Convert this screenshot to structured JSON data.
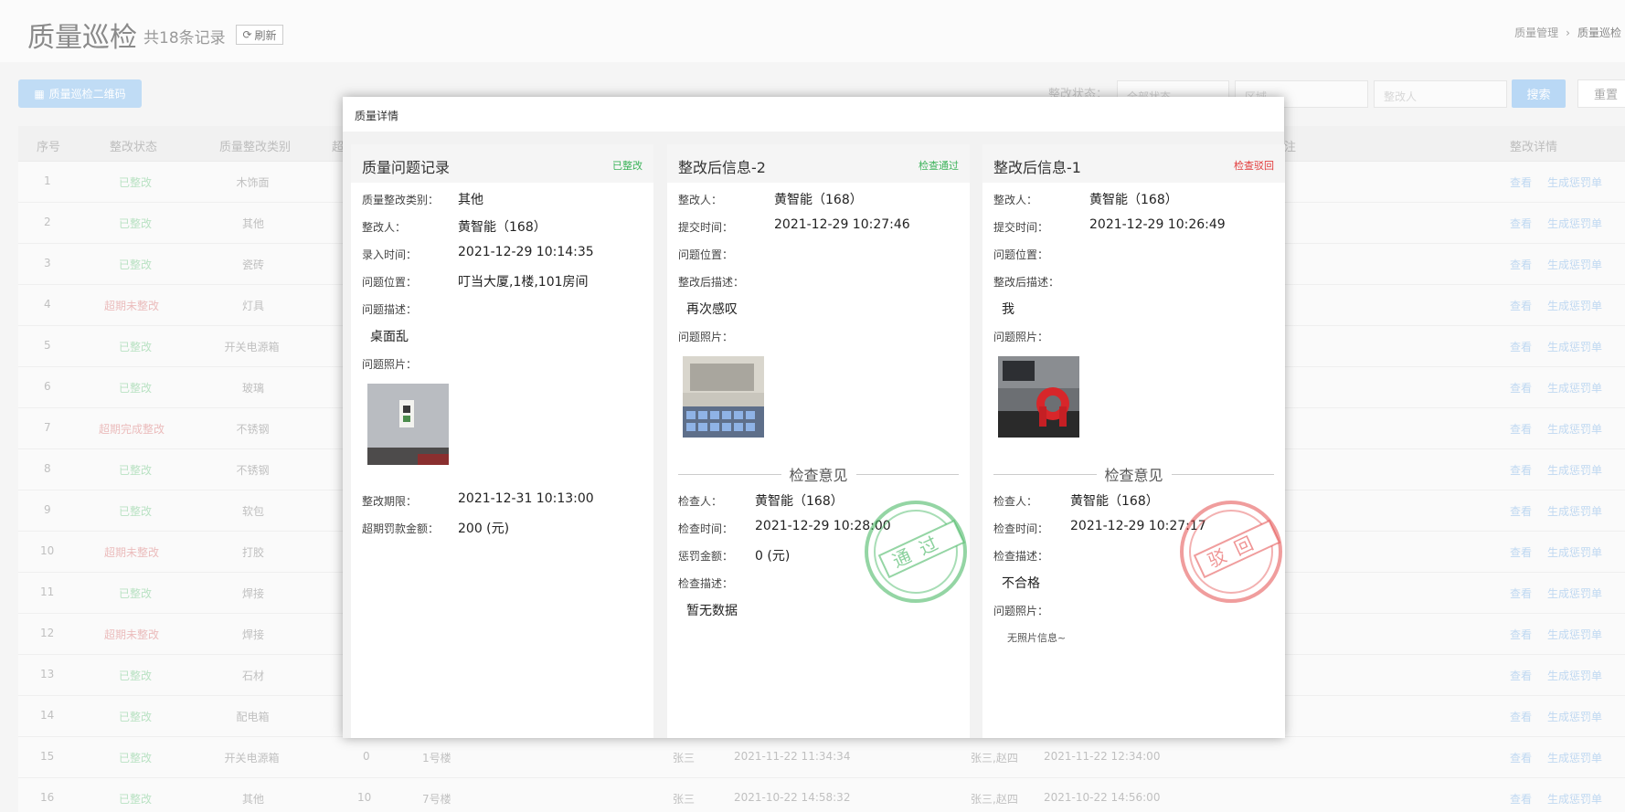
{
  "header": {
    "title": "质量巡检",
    "count": "共18条记录",
    "refresh_label": "刷新",
    "breadcrumb": [
      "质量管理",
      "质量巡检"
    ]
  },
  "toolbar": {
    "qr_button": "质量巡检二维码",
    "filter_label": "整改状态：",
    "status_select": "全部状态",
    "area_placeholder": "区域",
    "person_placeholder": "整改人",
    "search_label": "搜索",
    "reset_label": "重置"
  },
  "table": {
    "headers": {
      "seq": "序号",
      "status": "整改状态",
      "category": "质量整改类别",
      "overdue": "超",
      "remark": "注",
      "details": "整改详情"
    },
    "rows": [
      {
        "seq": "1",
        "status": "已整改",
        "category": "木饰面"
      },
      {
        "seq": "2",
        "status": "已整改",
        "category": "其他"
      },
      {
        "seq": "3",
        "status": "已整改",
        "category": "瓷砖"
      },
      {
        "seq": "4",
        "status": "超期未整改",
        "category": "灯具"
      },
      {
        "seq": "5",
        "status": "已整改",
        "category": "开关电源箱"
      },
      {
        "seq": "6",
        "status": "已整改",
        "category": "玻璃"
      },
      {
        "seq": "7",
        "status": "超期完成整改",
        "category": "不锈钢"
      },
      {
        "seq": "8",
        "status": "已整改",
        "category": "不锈钢"
      },
      {
        "seq": "9",
        "status": "已整改",
        "category": "软包"
      },
      {
        "seq": "10",
        "status": "超期未整改",
        "category": "打胶"
      },
      {
        "seq": "11",
        "status": "已整改",
        "category": "焊接"
      },
      {
        "seq": "12",
        "status": "超期未整改",
        "category": "焊接"
      },
      {
        "seq": "13",
        "status": "已整改",
        "category": "石材"
      },
      {
        "seq": "14",
        "status": "已整改",
        "category": "配电箱"
      },
      {
        "seq": "15",
        "status": "已整改",
        "category": "开关电源箱",
        "overdue": "0",
        "location": "1号楼",
        "submitter": "张三",
        "time1": "2021-11-22 11:34:34",
        "assignees": "张三,赵四",
        "time2": "2021-11-22 12:34:00"
      },
      {
        "seq": "16",
        "status": "已整改",
        "category": "其他",
        "overdue": "10",
        "location": "7号楼",
        "submitter": "张三",
        "time1": "2021-10-22 14:58:32",
        "assignees": "张三,赵四",
        "time2": "2021-10-22 14:56:00"
      }
    ],
    "actions": {
      "view": "查看",
      "penalty": "生成惩罚单"
    }
  },
  "modal": {
    "title": "质量详情",
    "record": {
      "title": "质量问题记录",
      "status": "已整改",
      "labels": {
        "category": "质量整改类别：",
        "person": "整改人：",
        "entry_time": "录入时间：",
        "location": "问题位置：",
        "desc": "问题描述：",
        "photos": "问题照片：",
        "deadline": "整改期限：",
        "penalty": "超期罚款金额："
      },
      "values": {
        "category": "其他",
        "person": "黄智能（168）",
        "entry_time": "2021-12-29 10:14:35",
        "location": "叮当大厦,1楼,101房间",
        "desc": "桌面乱",
        "deadline": "2021-12-31 10:13:00",
        "penalty": "200 (元)"
      }
    },
    "after2": {
      "title": "整改后信息-2",
      "status": "检查通过",
      "labels": {
        "person": "整改人：",
        "submit_time": "提交时间：",
        "location": "问题位置：",
        "desc": "整改后描述：",
        "photos": "问题照片："
      },
      "values": {
        "person": "黄智能（168）",
        "submit_time": "2021-12-29 10:27:46",
        "desc": "再次感叹"
      },
      "review": {
        "heading": "检查意见",
        "labels": {
          "inspector": "检查人：",
          "time": "检查时间：",
          "penalty": "惩罚金额：",
          "desc": "检查描述："
        },
        "values": {
          "inspector": "黄智能（168）",
          "time": "2021-12-29 10:28:00",
          "penalty": "0 (元)",
          "desc": "暂无数据"
        },
        "stamp": "通过"
      }
    },
    "after1": {
      "title": "整改后信息-1",
      "status": "检查驳回",
      "labels": {
        "person": "整改人：",
        "submit_time": "提交时间：",
        "location": "问题位置：",
        "desc": "整改后描述：",
        "photos": "问题照片："
      },
      "values": {
        "person": "黄智能（168）",
        "submit_time": "2021-12-29 10:26:49",
        "desc": "我"
      },
      "review": {
        "heading": "检查意见",
        "labels": {
          "inspector": "检查人：",
          "time": "检查时间：",
          "desc": "检查描述：",
          "photos": "问题照片："
        },
        "values": {
          "inspector": "黄智能（168）",
          "time": "2021-12-29 10:27:17",
          "desc": "不合格",
          "no_photo": "无照片信息~"
        },
        "stamp": "驳回"
      }
    }
  },
  "colors": {
    "green": "#3cb35a",
    "red": "#e23b3b",
    "link": "#4a90e2",
    "primary": "#5aaaf0"
  }
}
